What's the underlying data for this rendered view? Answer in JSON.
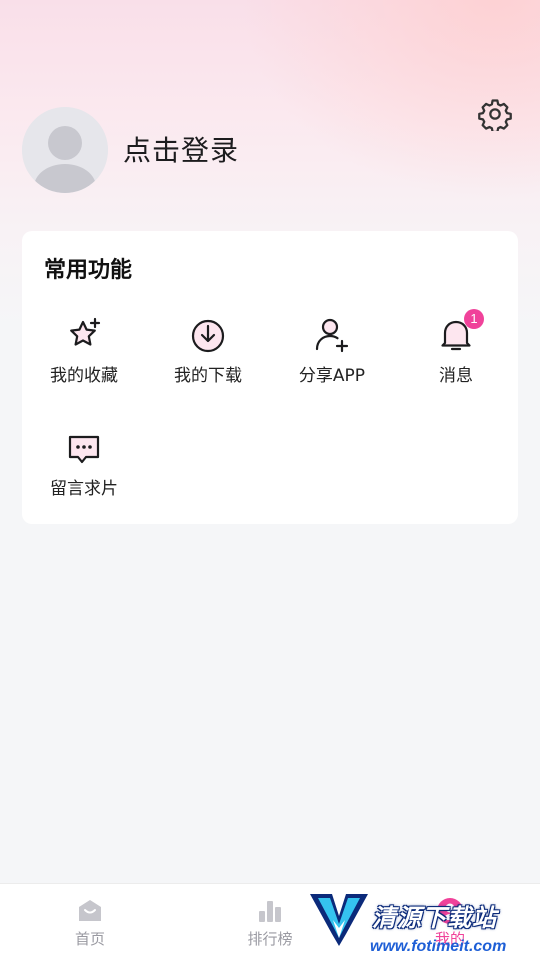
{
  "header": {
    "login_text": "点击登录"
  },
  "functions": {
    "title": "常用功能",
    "items": [
      {
        "label": "我的收藏",
        "icon": "star-plus-icon"
      },
      {
        "label": "我的下载",
        "icon": "download-icon"
      },
      {
        "label": "分享APP",
        "icon": "user-add-icon"
      },
      {
        "label": "消息",
        "icon": "bell-icon",
        "badge": "1"
      },
      {
        "label": "留言求片",
        "icon": "message-icon"
      }
    ]
  },
  "tabbar": {
    "tabs": [
      {
        "label": "首页",
        "icon": "home-icon"
      },
      {
        "label": "排行榜",
        "icon": "bar-chart-icon"
      },
      {
        "label": "我的",
        "icon": "profile-icon",
        "active": true
      }
    ]
  },
  "watermark": {
    "title": "清源下载站",
    "url": "www.fotimeit.com"
  },
  "colors": {
    "accent": "#f0429a",
    "tab_inactive": "#9a9aa2"
  }
}
